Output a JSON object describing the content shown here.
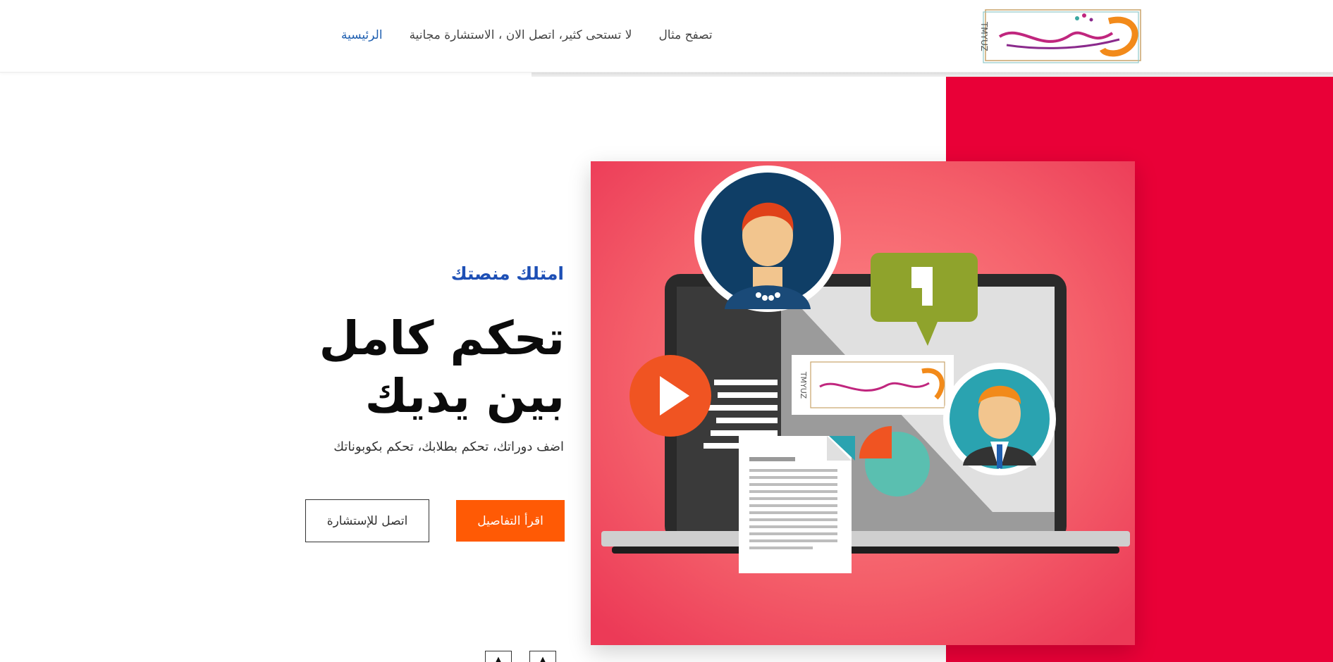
{
  "header": {
    "logo_alt": "تميز",
    "logo_latin": "TMYUZ",
    "nav": [
      {
        "label": "الرئيسية",
        "active": true
      },
      {
        "label": "لا تستحى كثير، اتصل الان ، الاستشارة مجانية",
        "active": false
      },
      {
        "label": "تصفح مثال",
        "active": false
      }
    ]
  },
  "hero": {
    "eyebrow": "امتلك منصتك",
    "headline_line1": "تحكم كامل",
    "headline_line2": "بين يديك",
    "subtext": "اضف دوراتك، تحكم بطلابك، تحكم بكوبوناتك",
    "primary_button": "اقرأ التفاصيل",
    "secondary_button": "اتصل للإستشارة"
  },
  "colors": {
    "accent_blue": "#1d4fb5",
    "primary_orange": "#ff5a05",
    "red_band": "#e90037"
  },
  "icons": {
    "arrow_prev": "▲",
    "arrow_next": "▲"
  }
}
